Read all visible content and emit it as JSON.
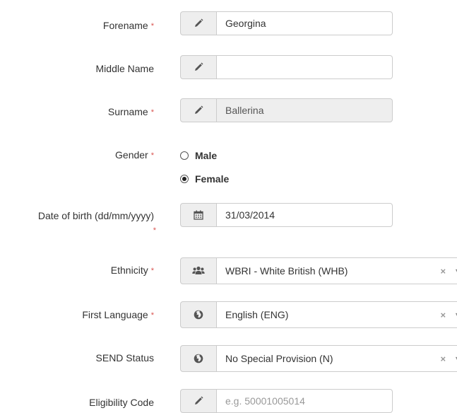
{
  "required_marker": "*",
  "fields": {
    "forename": {
      "label": "Forename",
      "value": "Georgina"
    },
    "middle_name": {
      "label": "Middle Name",
      "value": ""
    },
    "surname": {
      "label": "Surname",
      "value": "Ballerina"
    },
    "gender": {
      "label": "Gender",
      "options": [
        "Male",
        "Female"
      ],
      "selected": "Female"
    },
    "dob": {
      "label": "Date of birth (dd/mm/yyyy)",
      "value": "31/03/2014"
    },
    "ethnicity": {
      "label": "Ethnicity",
      "value": "WBRI - White British (WHB)"
    },
    "first_language": {
      "label": "First Language",
      "value": "English (ENG)"
    },
    "send_status": {
      "label": "SEND Status",
      "value": "No Special Provision (N)"
    },
    "eligibility_code": {
      "label": "Eligibility Code",
      "placeholder": "e.g. 50001005014"
    }
  },
  "icons": {
    "edit": "pencil-icon",
    "date": "calendar-icon",
    "group": "users-icon",
    "globe": "globe-icon"
  },
  "select_clear": "×",
  "select_arrow": "▼",
  "colors": {
    "required": "#d9534f",
    "addon_bg": "#eeeeee",
    "border": "#cccccc",
    "placeholder": "#999999"
  }
}
